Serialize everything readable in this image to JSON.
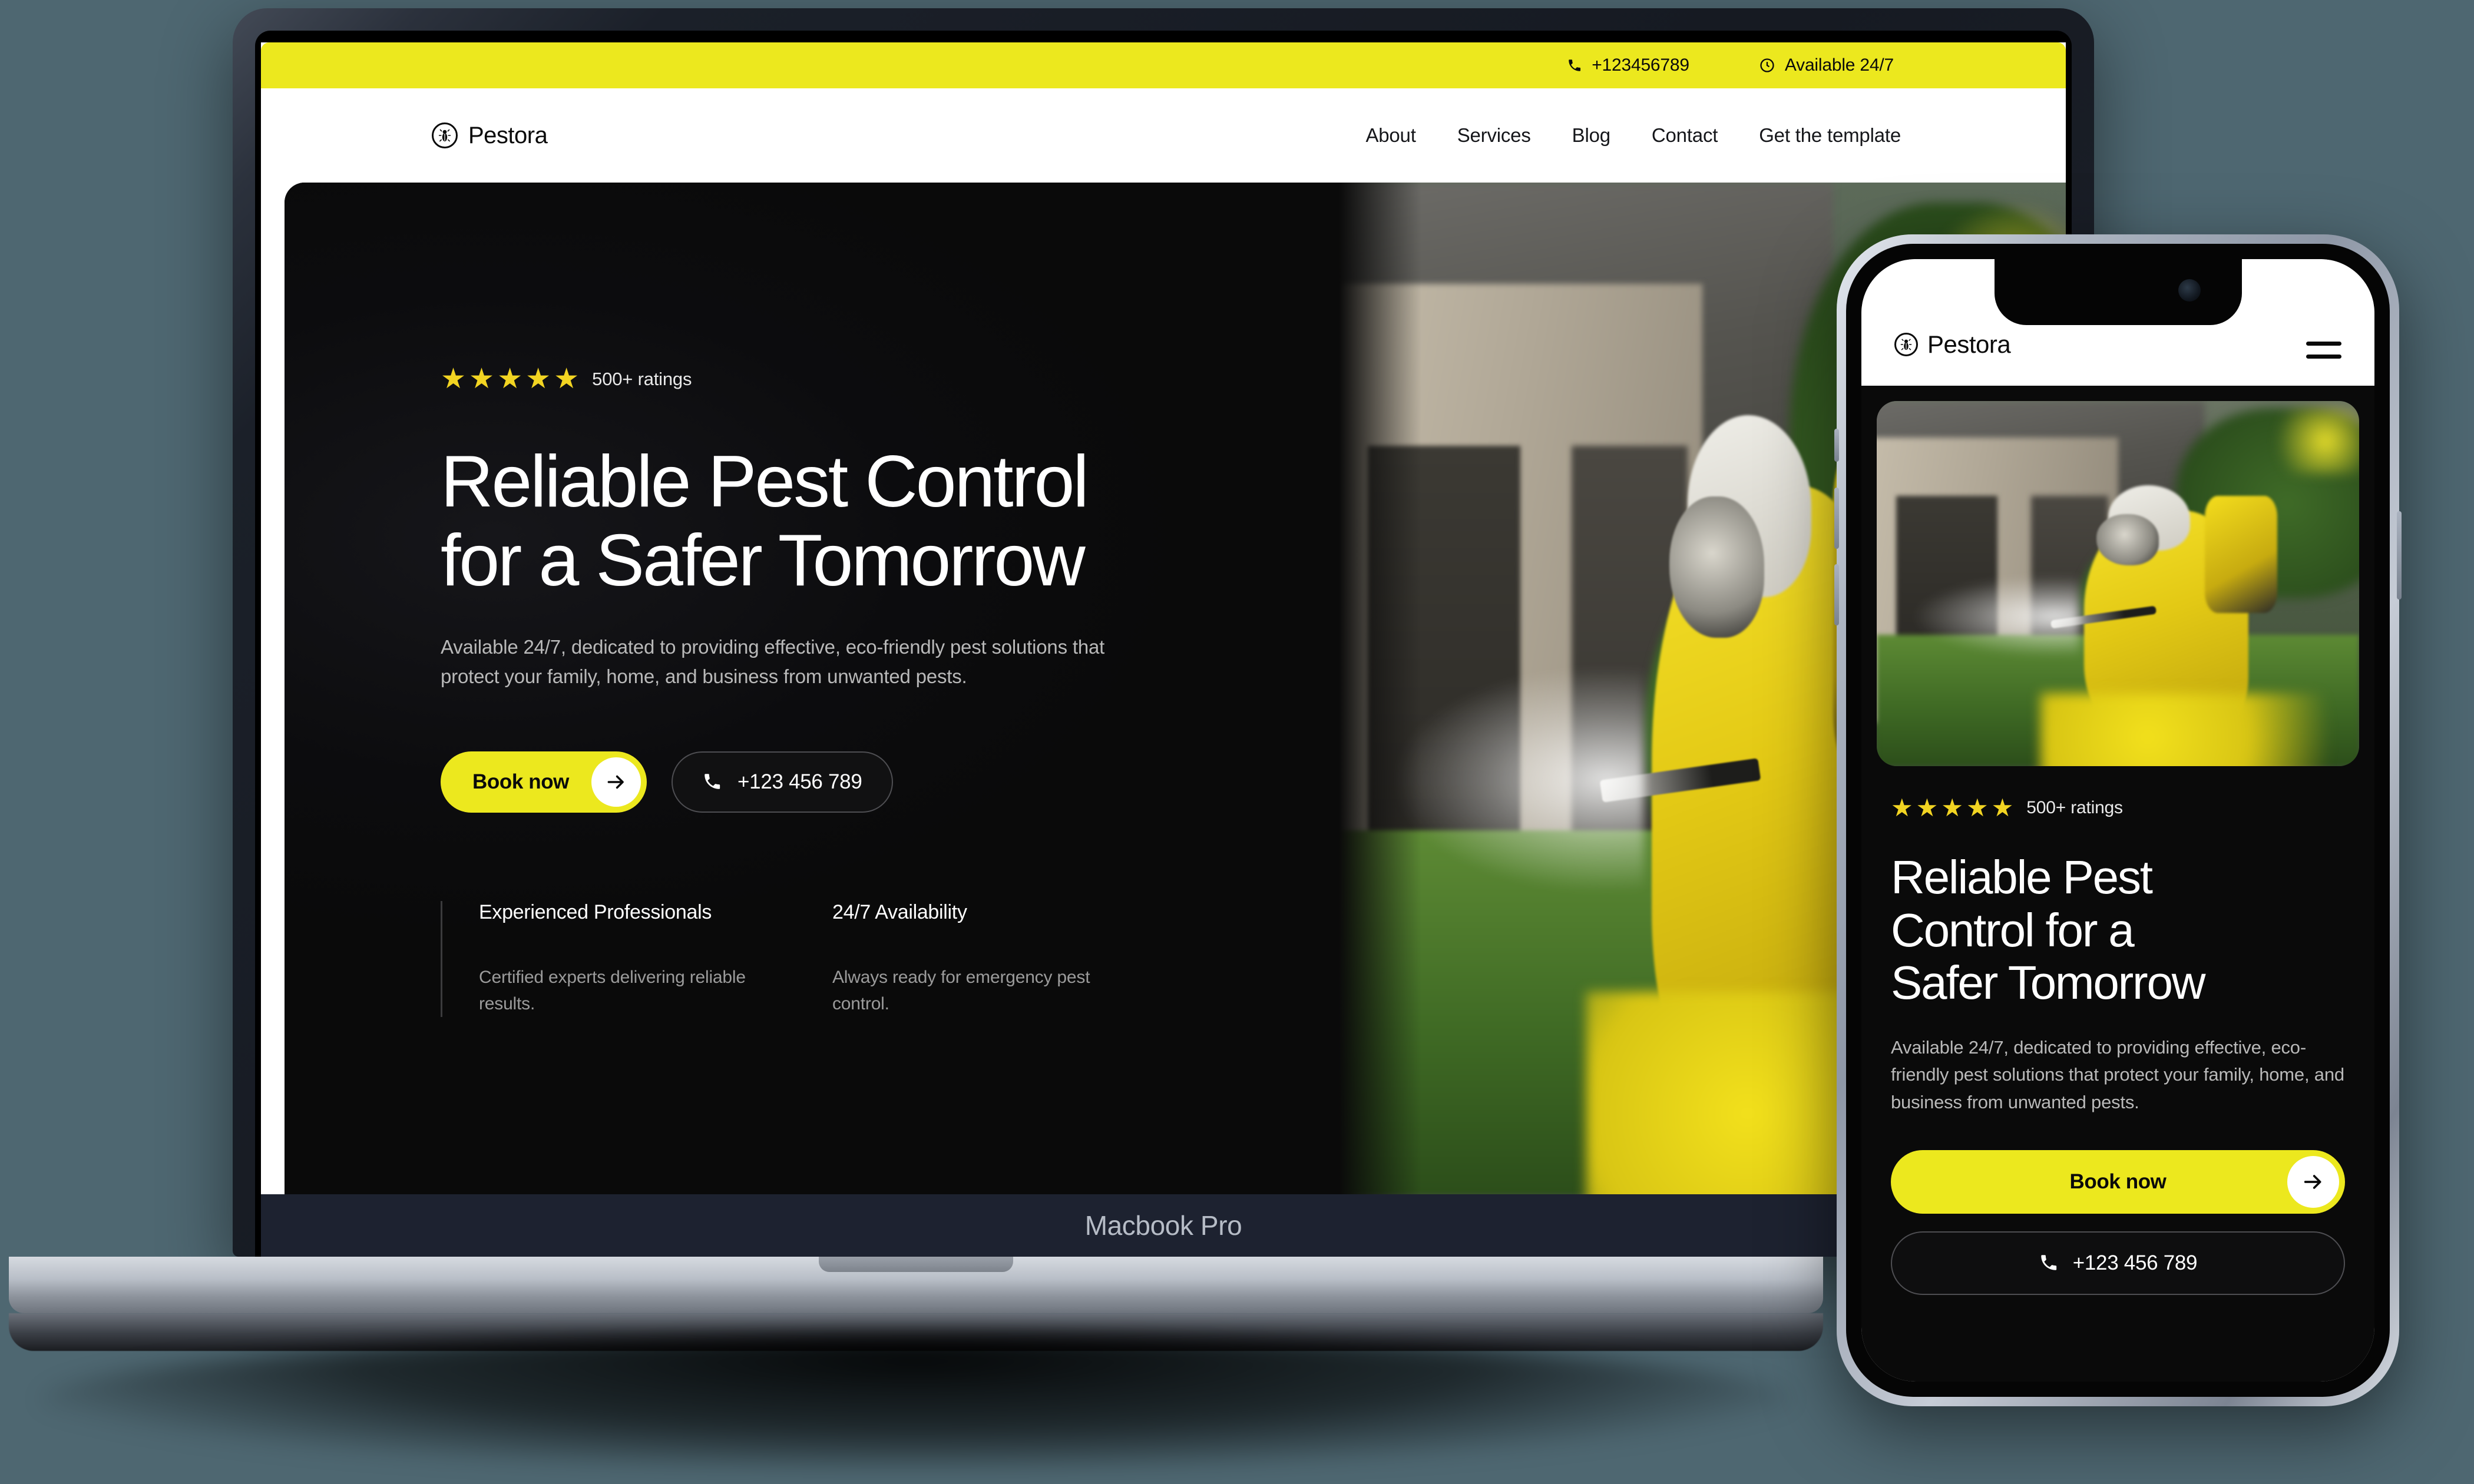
{
  "background_color": "#4e6771",
  "accent_yellow": "#ece81e",
  "devices": {
    "laptop_label": "Macbook Pro"
  },
  "site": {
    "topbar": {
      "phone": "+123456789",
      "availability": "Available 24/7",
      "phone_icon": "phone-icon",
      "clock_icon": "clock-icon"
    },
    "brand": {
      "name": "Pestora",
      "logo_icon": "bug-logo-icon"
    },
    "nav": [
      {
        "label": "About"
      },
      {
        "label": "Services"
      },
      {
        "label": "Blog"
      },
      {
        "label": "Contact"
      },
      {
        "label": "Get the template"
      }
    ],
    "hero": {
      "rating_count": "500+ ratings",
      "stars": 5,
      "star_glyph": "★",
      "heading_line1": "Reliable Pest Control",
      "heading_line2": "for a Safer Tomorrow",
      "paragraph": "Available 24/7, dedicated to providing effective, eco-friendly pest solutions that protect your family, home, and business from unwanted pests.",
      "cta_primary": "Book now",
      "cta_primary_icon": "arrow-right-icon",
      "cta_secondary": "+123 456 789",
      "cta_secondary_icon": "phone-icon",
      "features": [
        {
          "title": "Experienced Professionals",
          "desc": "Certified experts delivering reliable results."
        },
        {
          "title": "24/7 Availability",
          "desc": "Always ready for emergency pest control."
        }
      ],
      "image_alt": "pest-control-technician-spraying"
    }
  },
  "mobile": {
    "brand": {
      "name": "Pestora",
      "logo_icon": "bug-logo-icon"
    },
    "menu_icon": "hamburger-menu-icon",
    "hero": {
      "rating_count": "500+ ratings",
      "stars": 5,
      "star_glyph": "★",
      "heading_line1": "Reliable Pest",
      "heading_line2": "Control for a",
      "heading_line3": "Safer Tomorrow",
      "paragraph": "Available 24/7, dedicated to providing effective, eco-friendly pest solutions that protect your family, home, and business from unwanted pests.",
      "cta_primary": "Book now",
      "cta_primary_icon": "arrow-right-icon",
      "cta_secondary": "+123 456 789",
      "cta_secondary_icon": "phone-icon",
      "image_alt": "pest-control-technician-spraying"
    }
  }
}
